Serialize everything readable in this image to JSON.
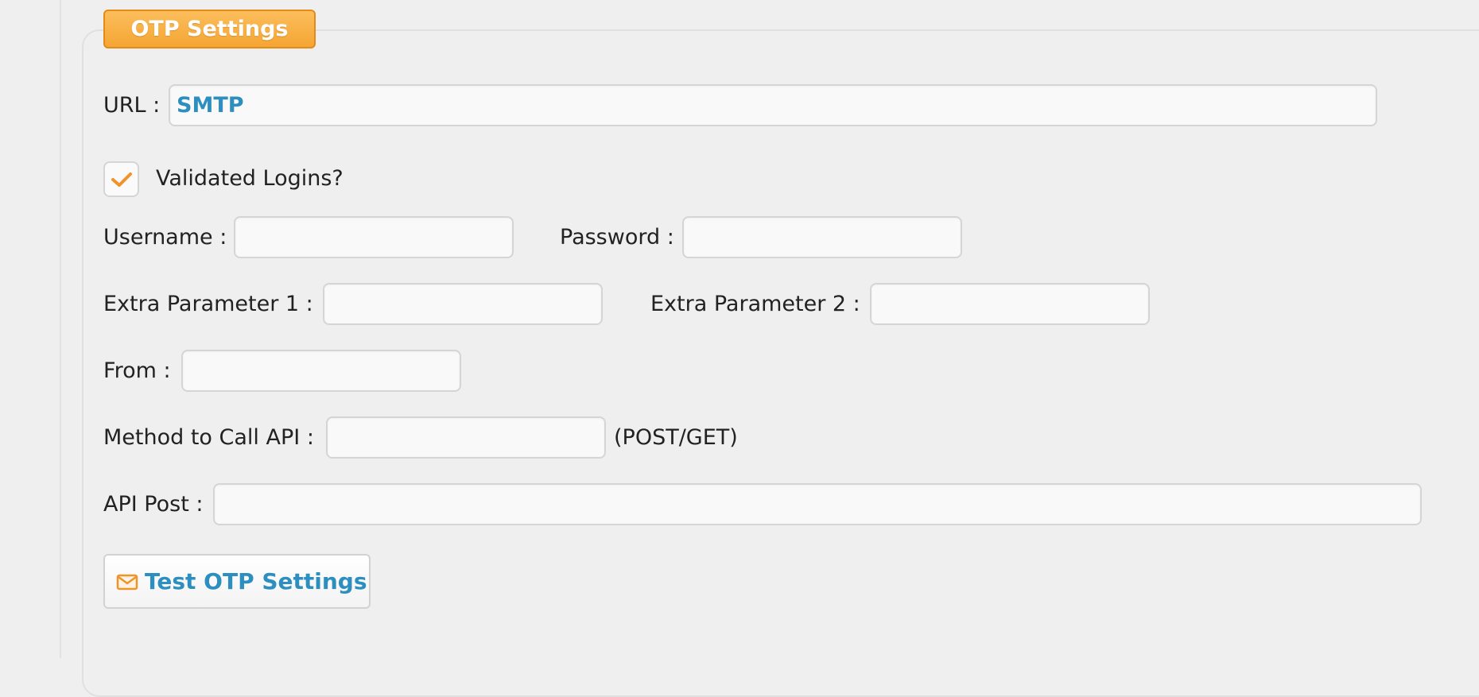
{
  "legend": {
    "title": "OTP Settings"
  },
  "url_field": {
    "label": "URL :",
    "value": "SMTP"
  },
  "validated_logins": {
    "label": "Validated Logins?",
    "checked": true
  },
  "username": {
    "label": "Username :",
    "value": ""
  },
  "password": {
    "label": "Password :",
    "value": ""
  },
  "extra_param_1": {
    "label": "Extra Parameter 1 :",
    "value": ""
  },
  "extra_param_2": {
    "label": "Extra Parameter 2 :",
    "value": ""
  },
  "from": {
    "label": "From :",
    "value": ""
  },
  "method": {
    "label": "Method to Call API :",
    "value": "",
    "hint": "(POST/GET)"
  },
  "api_post": {
    "label": "API Post :",
    "value": ""
  },
  "test_button": {
    "label": "Test OTP Settings",
    "icon": "envelope-icon"
  },
  "colors": {
    "accent_orange": "#f5a533",
    "link_blue": "#2c8fbf"
  }
}
